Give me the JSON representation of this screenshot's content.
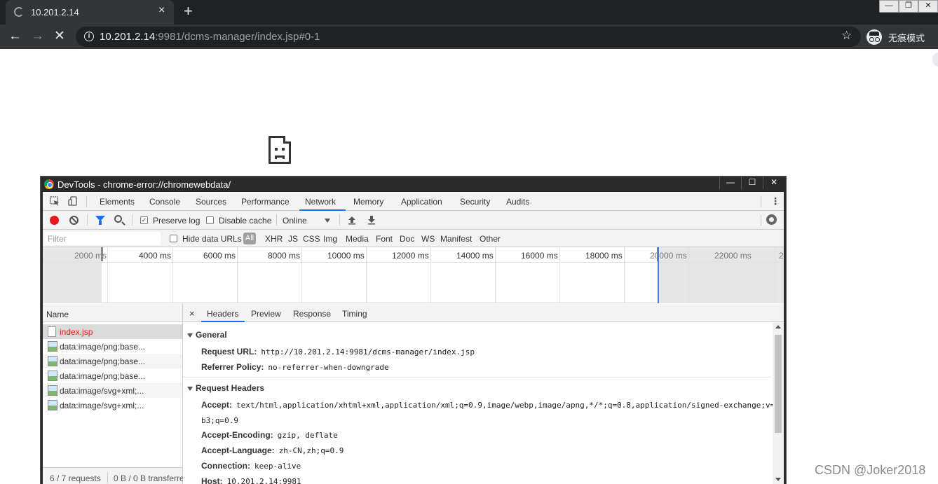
{
  "browser": {
    "tab_title": "10.201.2.14",
    "tab_close": "×",
    "new_tab": "+",
    "window_controls": [
      "—",
      "❐",
      "✕"
    ],
    "url_host": "10.201.2.14",
    "url_rest": ":9981/dcms-manager/index.jsp#0-1",
    "incognito_label": "无痕模式"
  },
  "devtools": {
    "window_title": "DevTools - chrome-error://chromewebdata/",
    "window_controls": [
      "—",
      "☐",
      "✕"
    ],
    "panels": [
      "Elements",
      "Console",
      "Sources",
      "Performance",
      "Network",
      "Memory",
      "Application",
      "Security",
      "Audits"
    ],
    "active_panel": "Network",
    "toolbar": {
      "preserve_log": "Preserve log",
      "preserve_log_checked": true,
      "disable_cache": "Disable cache",
      "disable_cache_checked": false,
      "throttling": "Online"
    },
    "filter": {
      "placeholder": "Filter",
      "hide_data_urls": "Hide data URLs",
      "types": [
        "All",
        "XHR",
        "JS",
        "CSS",
        "Img",
        "Media",
        "Font",
        "Doc",
        "WS",
        "Manifest",
        "Other"
      ],
      "active_type": "All"
    },
    "timeline_ticks": [
      "2000 ms",
      "4000 ms",
      "6000 ms",
      "8000 ms",
      "10000 ms",
      "12000 ms",
      "14000 ms",
      "16000 ms",
      "18000 ms",
      "20000 ms",
      "22000 ms",
      "2"
    ],
    "requests_header": "Name",
    "requests": [
      {
        "name": "index.jsp",
        "type": "doc",
        "error": true,
        "selected": true
      },
      {
        "name": "data:image/png;base...",
        "type": "img"
      },
      {
        "name": "data:image/png;base...",
        "type": "img"
      },
      {
        "name": "data:image/png;base...",
        "type": "img"
      },
      {
        "name": "data:image/svg+xml;...",
        "type": "img"
      },
      {
        "name": "data:image/svg+xml;...",
        "type": "img"
      }
    ],
    "status": {
      "requests": "6 / 7 requests",
      "transferred": "0 B / 0 B transferre"
    },
    "detail_close": "×",
    "detail_tabs": [
      "Headers",
      "Preview",
      "Response",
      "Timing"
    ],
    "active_detail_tab": "Headers",
    "general": {
      "title": "General",
      "rows": [
        {
          "key": "Request URL:",
          "value": "http://10.201.2.14:9981/dcms-manager/index.jsp"
        },
        {
          "key": "Referrer Policy:",
          "value": "no-referrer-when-downgrade"
        }
      ]
    },
    "request_headers": {
      "title": "Request Headers",
      "accept_key": "Accept:",
      "accept_value_1": "text/html,application/xhtml+xml,application/xml;q=0.9,image/webp,image/apng,*/*;q=0.8,application/signed-exchange;v=",
      "accept_value_2": "b3;q=0.9",
      "rows": [
        {
          "key": "Accept-Encoding:",
          "value": "gzip, deflate"
        },
        {
          "key": "Accept-Language:",
          "value": "zh-CN,zh;q=0.9"
        },
        {
          "key": "Connection:",
          "value": "keep-alive"
        },
        {
          "key": "Host:",
          "value": "10.201.2.14:9981"
        }
      ]
    }
  },
  "watermark": "CSDN @Joker2018"
}
